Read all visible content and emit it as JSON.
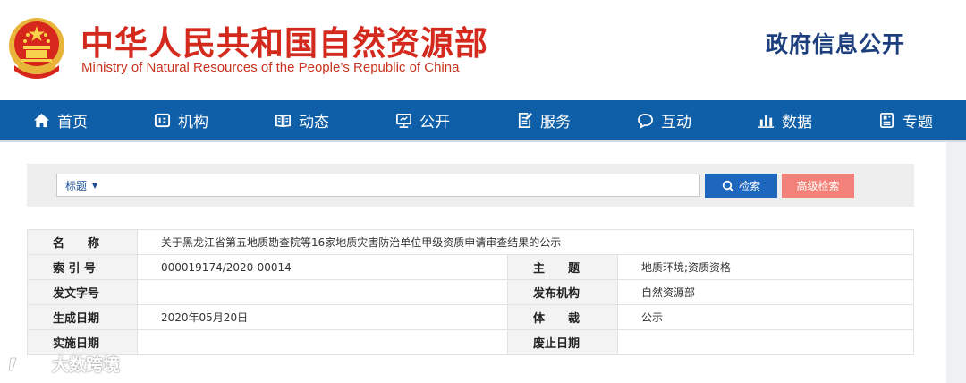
{
  "header": {
    "title_cn": "中华人民共和国自然资源部",
    "title_en": "Ministry of Natural Resources of the People’s Republic of China",
    "right_title": "政府信息公开"
  },
  "nav": {
    "items": [
      {
        "label": "首页",
        "icon": "home-icon"
      },
      {
        "label": "机构",
        "icon": "institution-icon"
      },
      {
        "label": "动态",
        "icon": "news-icon"
      },
      {
        "label": "公开",
        "icon": "disclosure-icon"
      },
      {
        "label": "服务",
        "icon": "service-icon"
      },
      {
        "label": "互动",
        "icon": "chat-icon"
      },
      {
        "label": "数据",
        "icon": "chart-icon"
      },
      {
        "label": "专题",
        "icon": "topic-icon"
      }
    ]
  },
  "search": {
    "type_label": "标题",
    "search_label": "检索",
    "advanced_label": "高级检索"
  },
  "info": {
    "name_label": "名　　称",
    "name_value": "关于黑龙江省第五地质勘查院等16家地质灾害防治单位甲级资质申请审查结果的公示",
    "index_label": "索 引 号",
    "index_value": "000019174/2020-00014",
    "subject_label": "主　　题",
    "subject_value": "地质环境;资质资格",
    "doc_no_label": "发文字号",
    "doc_no_value": "",
    "publisher_label": "发布机构",
    "publisher_value": "自然资源部",
    "date_label": "生成日期",
    "date_value": "2020年05月20日",
    "genre_label": "体　　裁",
    "genre_value": "公示",
    "effective_label": "实施日期",
    "effective_value": "",
    "expiry_label": "废止日期",
    "expiry_value": ""
  },
  "watermark": {
    "text": "大数跨境"
  },
  "colors": {
    "brand_red": "#d42a1d",
    "nav_blue": "#0f5fa8",
    "search_blue": "#1d67be",
    "advanced_pink": "#f28279"
  }
}
